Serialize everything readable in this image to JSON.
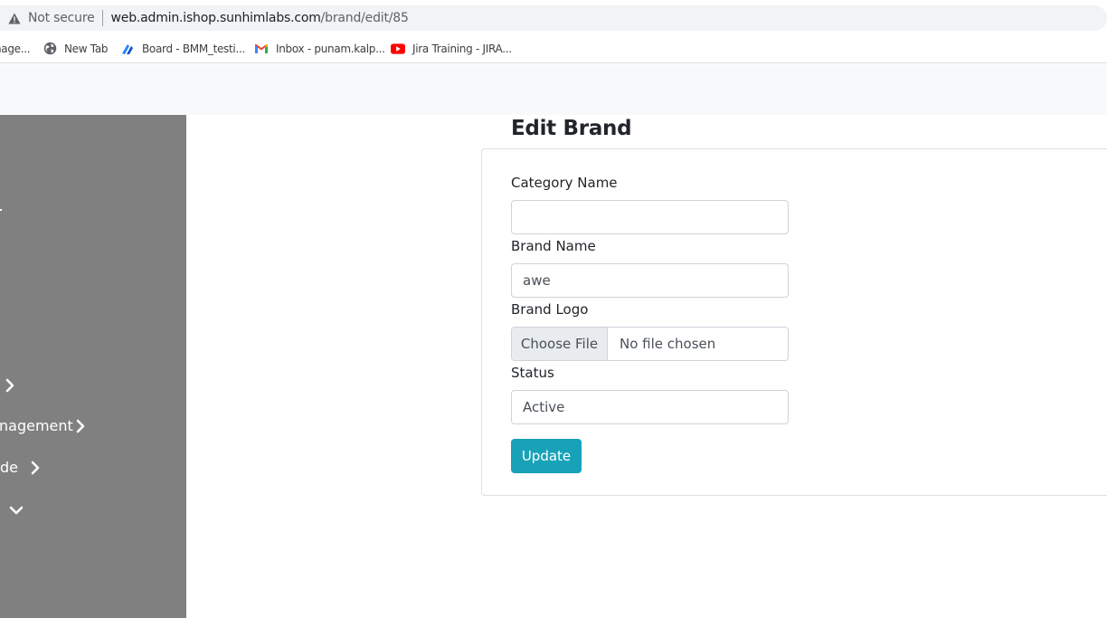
{
  "browser": {
    "security_label": "Not secure",
    "url_host": "web.admin.ishop.sunhimlabs.com",
    "url_path": "/brand/edit/85",
    "bookmarks": [
      {
        "label": "nage...",
        "icon": "none"
      },
      {
        "label": "New Tab",
        "icon": "globe-icon"
      },
      {
        "label": "Board - BMM_testi...",
        "icon": "jira-board-icon"
      },
      {
        "label": "Inbox - punam.kalp...",
        "icon": "gmail-icon"
      },
      {
        "label": "Jira Training - JIRA...",
        "icon": "youtube-icon"
      }
    ]
  },
  "sidebar": {
    "items": [
      {
        "label": "",
        "chevron": "right"
      },
      {
        "label": "nagement",
        "chevron": "right"
      },
      {
        "label": "de",
        "chevron": "right"
      },
      {
        "label": "",
        "chevron": "down"
      }
    ]
  },
  "page": {
    "title": "Edit Brand"
  },
  "form": {
    "category_label": "Category Name",
    "category_value": "",
    "brand_label": "Brand Name",
    "brand_value": "awe",
    "logo_label": "Brand Logo",
    "logo_button": "Choose File",
    "logo_status": "No file chosen",
    "status_label": "Status",
    "status_value": "Active",
    "submit_label": "Update"
  },
  "colors": {
    "sidebar_bg": "#808080",
    "button_bg": "#17a2b8",
    "navbar_bg": "#f8f9fa"
  }
}
